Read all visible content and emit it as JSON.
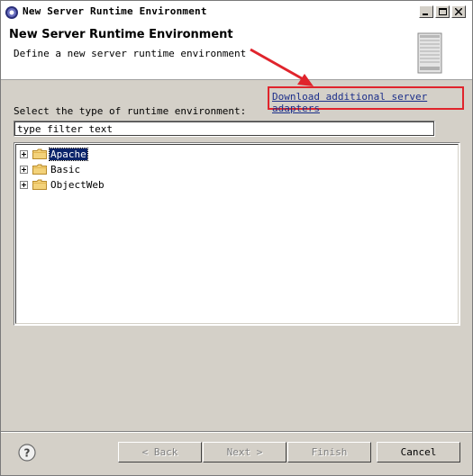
{
  "window": {
    "title": "New Server Runtime Environment",
    "controls": [
      "minimize",
      "maximize",
      "close"
    ]
  },
  "header": {
    "title": "New Server Runtime Environment",
    "description": "Define a new server runtime environment"
  },
  "download_link": "Download additional server adapters",
  "select_label": "Select the type of runtime environment:",
  "filter": {
    "value": "type filter text"
  },
  "tree": {
    "items": [
      {
        "label": "Apache",
        "selected": true
      },
      {
        "label": "Basic",
        "selected": false
      },
      {
        "label": "ObjectWeb",
        "selected": false
      }
    ]
  },
  "buttons": {
    "back": "< Back",
    "next": "Next >",
    "finish": "Finish",
    "cancel": "Cancel"
  },
  "colors": {
    "annotation_red": "#e0242c",
    "link_blue": "#1b2e8a",
    "selection": "#0a246a",
    "dialog_bg": "#d4d0c8"
  },
  "icons": [
    "app-icon",
    "server-icon",
    "folder-icon",
    "help-icon"
  ]
}
